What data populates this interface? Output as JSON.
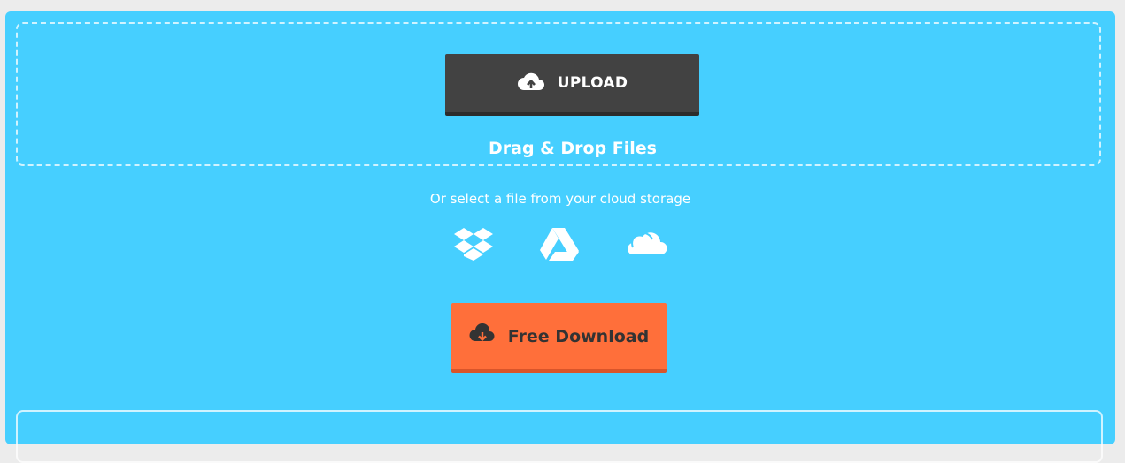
{
  "upload": {
    "label": "UPLOAD",
    "icon": "cloud-upload-icon"
  },
  "dropzone": {
    "text": "Drag & Drop Files"
  },
  "cloud": {
    "prompt": "Or select a file from your cloud storage",
    "providers": [
      {
        "name": "dropbox-icon"
      },
      {
        "name": "google-drive-icon"
      },
      {
        "name": "onedrive-icon"
      }
    ]
  },
  "download": {
    "label": "Free Download",
    "icon": "cloud-download-icon"
  },
  "colors": {
    "panel": "#46cfff",
    "upload_button": "#424242",
    "download_button": "#ff6f3a",
    "page_background": "#ececec"
  }
}
